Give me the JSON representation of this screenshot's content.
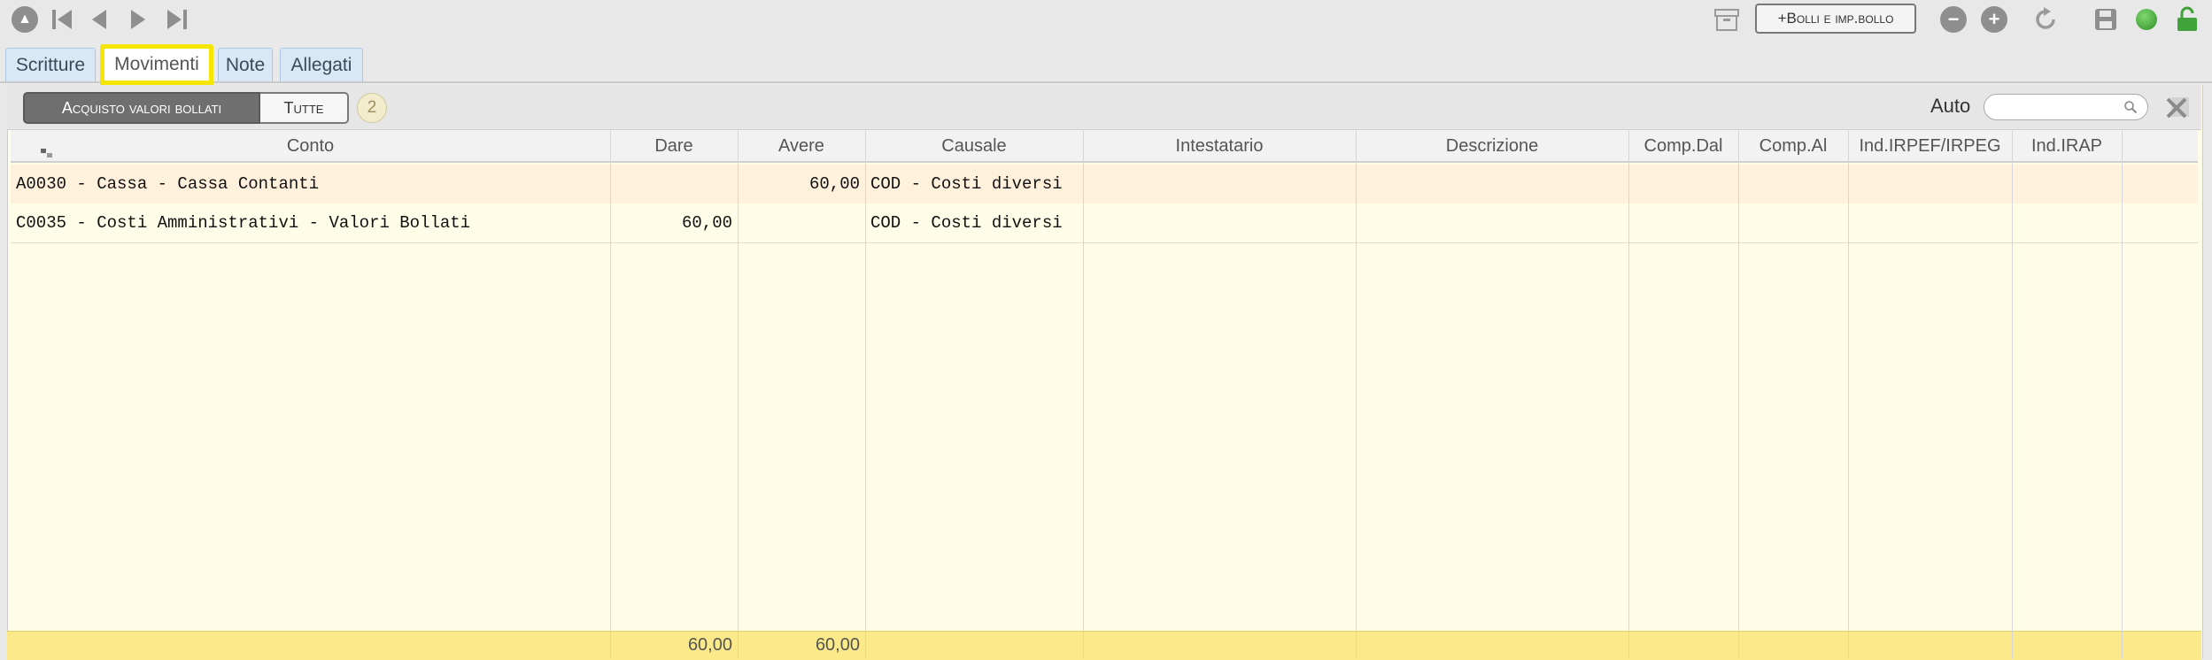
{
  "toolbar": {
    "nav_icons": [
      "home-icon",
      "first-record-icon",
      "previous-record-icon",
      "next-record-icon",
      "last-record-icon"
    ],
    "bolli_button": {
      "prefix": "+ ",
      "label": "Bolli e imp.bollo"
    },
    "right_icons": [
      "archive-icon",
      "remove-icon",
      "add-icon",
      "refresh-icon",
      "save-icon",
      "status-green-icon",
      "unlock-icon"
    ]
  },
  "tabs": [
    {
      "label": "Scritture"
    },
    {
      "label": "Movimenti",
      "active": true
    },
    {
      "label": "Note"
    },
    {
      "label": "Allegati"
    }
  ],
  "filter": {
    "segment_active": "Acquisto valori bollati",
    "segment_other": "Tutte",
    "count": "2",
    "auto_label": "Auto",
    "search_value": "",
    "search_placeholder": ""
  },
  "table": {
    "columns": [
      "Conto",
      "Dare",
      "Avere",
      "Causale",
      "Intestatario",
      "Descrizione",
      "Comp.Dal",
      "Comp.Al",
      "Ind.IRPEF/IRPEG",
      "Ind.IRAP",
      ""
    ],
    "rows": [
      {
        "conto": "A0030 - Cassa - Cassa Contanti",
        "dare": "",
        "avere": "60,00",
        "causale": "COD - Costi diversi",
        "intestatario": "",
        "descrizione": "",
        "comp_dal": "",
        "comp_al": "",
        "ind_irpef": "",
        "ind_irap": ""
      },
      {
        "conto": "C0035 - Costi Amministrativi - Valori Bollati",
        "dare": "60,00",
        "avere": "",
        "causale": "COD - Costi diversi",
        "intestatario": "",
        "descrizione": "",
        "comp_dal": "",
        "comp_al": "",
        "ind_irpef": "",
        "ind_irap": ""
      }
    ],
    "totals": {
      "dare": "60,00",
      "avere": "60,00"
    }
  },
  "colors": {
    "active_tab_outline": "#f4e600",
    "row_highlight": "#fff1dc",
    "grid_background": "#fffde8",
    "totals_background": "#fbe98a",
    "tab_background": "#d9e8f7",
    "status_green": "#3fa23a"
  }
}
